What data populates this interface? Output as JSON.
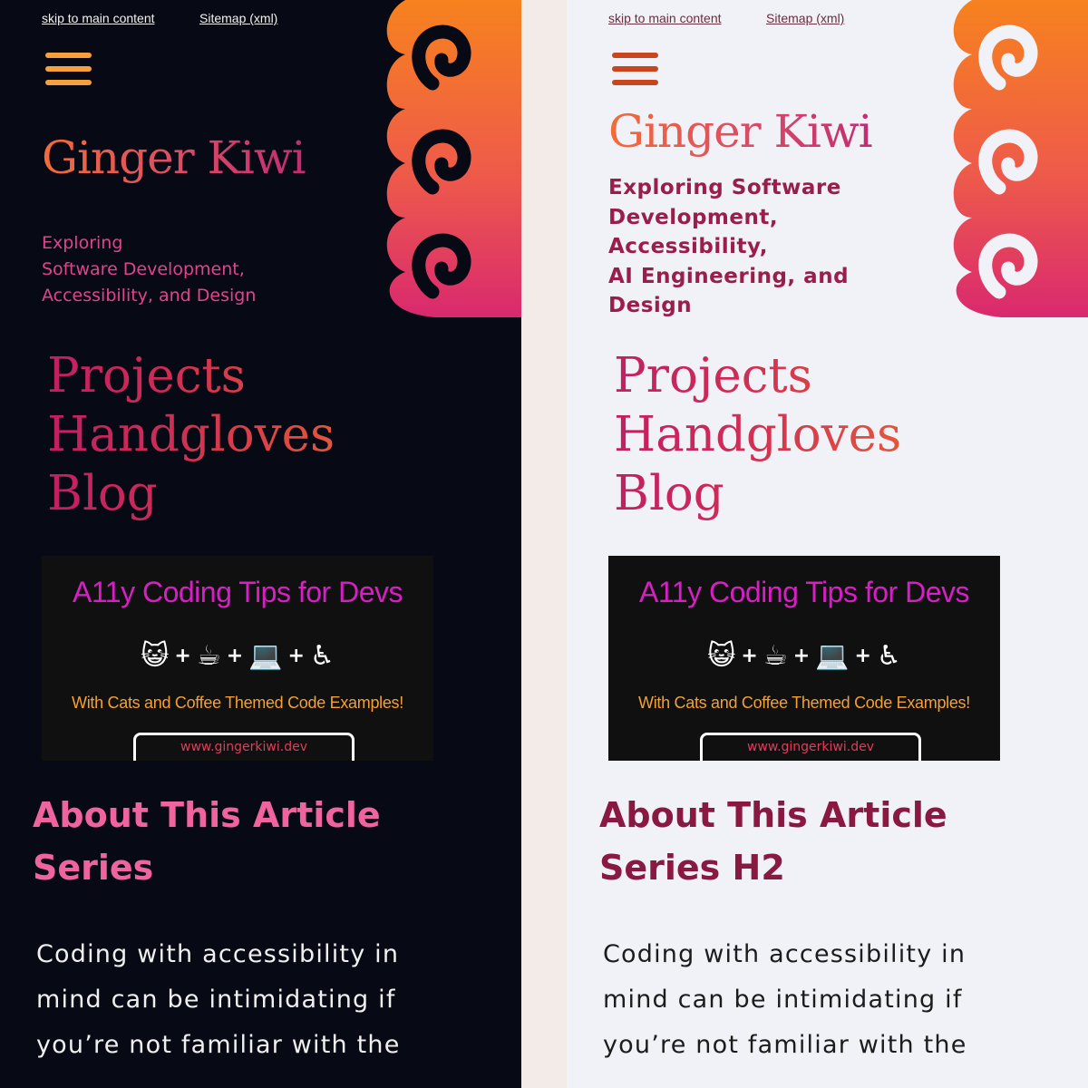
{
  "dark": {
    "skip_link": "skip to main content",
    "sitemap_link": "Sitemap (xml)",
    "site_title": "Ginger Kiwi",
    "tagline_lines": [
      "Exploring",
      "Software Development,",
      "Accessibility, and Design"
    ],
    "nav": [
      "Projects",
      "Handgloves",
      "Blog"
    ],
    "promo": {
      "title": "A11y Coding Tips  for Devs",
      "emoji": [
        "😺",
        "☕",
        "💻",
        "♿"
      ],
      "plus": "+",
      "subtitle": "With Cats and Coffee Themed Code Examples!",
      "url": "www.gingerkiwi.dev"
    },
    "article_heading": "About This Article Series",
    "paragraph_lines": [
      "Coding with accessibility in",
      "mind can be intimidating if",
      "you’re not familiar with the"
    ]
  },
  "light": {
    "skip_link": "skip to main content",
    "sitemap_link": "Sitemap (xml)",
    "site_title": "Ginger Kiwi",
    "tagline_lines": [
      "Exploring Software",
      "Development,",
      "Accessibility,",
      "AI Engineering, and",
      "Design"
    ],
    "nav": [
      "Projects",
      "Handgloves",
      "Blog"
    ],
    "promo": {
      "title": "A11y Coding Tips  for Devs",
      "emoji": [
        "😺",
        "☕",
        "💻",
        "♿"
      ],
      "plus": "+",
      "subtitle": "With Cats and Coffee Themed Code Examples!",
      "url": "www.gingerkiwi.dev"
    },
    "article_heading": "About This Article Series H2",
    "paragraph_lines": [
      "Coding with accessibility in",
      "mind can be intimidating if",
      "you’re not familiar with the"
    ]
  },
  "icons": {
    "menu": "hamburger-menu-icon",
    "decoration": "spiral-decoration"
  },
  "colors": {
    "dark_bg": "#070914",
    "light_bg": "#f1f2f8",
    "outer_bg": "#f3ebe7",
    "orange": "#f7821e",
    "pink": "#d9296f"
  }
}
